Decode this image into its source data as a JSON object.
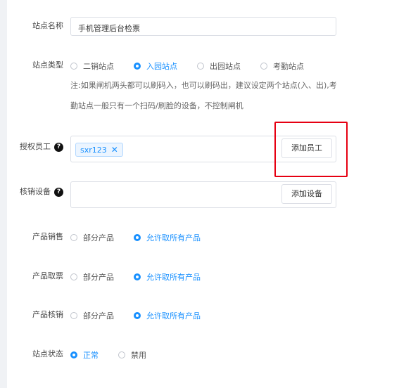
{
  "site_name": {
    "label": "站点名称",
    "value": "手机管理后台检票"
  },
  "site_type": {
    "label": "站点类型",
    "options": [
      "二销站点",
      "入园站点",
      "出园站点",
      "考勤站点"
    ],
    "selected": "入园站点",
    "note_line1": "注:如果闸机两头都可以刷码入，也可以刷码出，建议设定两个站点(入、出),考",
    "note_line2": "勤站点一般只有一个扫码/刷脸的设备，不控制闸机"
  },
  "staff": {
    "label": "授权员工",
    "help": "?",
    "tag": "sxr123",
    "tag_close": "✕",
    "add_button": "添加员工"
  },
  "device": {
    "label": "核销设备",
    "help": "?",
    "add_button": "添加设备"
  },
  "product_sales": {
    "label": "产品销售",
    "options": [
      "部分产品",
      "允许取所有产品"
    ],
    "selected": "允许取所有产品"
  },
  "product_pickup": {
    "label": "产品取票",
    "options": [
      "部分产品",
      "允许取所有产品"
    ],
    "selected": "允许取所有产品"
  },
  "product_verify": {
    "label": "产品核销",
    "options": [
      "部分产品",
      "允许取所有产品"
    ],
    "selected": "允许取所有产品"
  },
  "site_status": {
    "label": "站点状态",
    "options": [
      "正常",
      "禁用"
    ],
    "selected": "正常"
  },
  "colors": {
    "accent": "#1890ff",
    "highlight": "#e60012"
  }
}
